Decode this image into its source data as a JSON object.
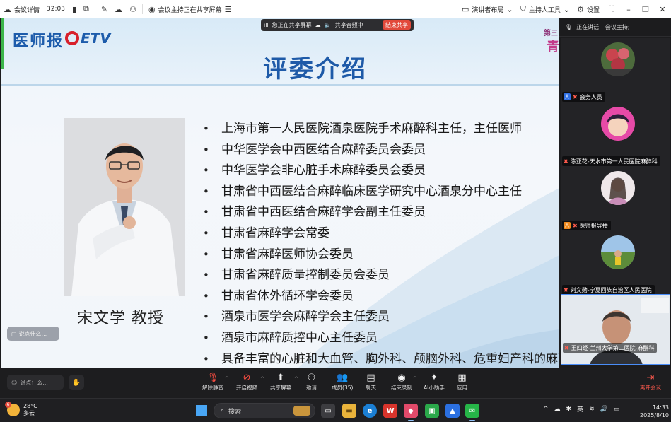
{
  "topbar": {
    "meeting_details": "会议详情",
    "duration": "32:03",
    "sharing_status": "会议主持正在共享屏幕",
    "presenter_layout": "演讲者布局",
    "host_tools": "主持人工具",
    "settings": "设置"
  },
  "share_bar": {
    "sharing_label": "您正在共享屏幕",
    "audio_label": "共享音频中",
    "end_share": "结束共享"
  },
  "slide": {
    "logo_text": "医师报",
    "logo_etv": "ETV",
    "title": "评委介绍",
    "corner_tag": "第三",
    "corner_tag2": "青",
    "person_name": "宋文学 教授",
    "bullets": [
      "上海市第一人民医院酒泉医院手术麻醉科主任，主任医师",
      "中华医学会中西医结合麻醉委员会委员",
      "中华医学会非心脏手术麻醉委员会委员",
      "甘肃省中西医结合麻醉临床医学研究中心酒泉分中心主任",
      "甘肃省中西医结合麻醉学会副主任委员",
      "甘肃省麻醉学会常委",
      "甘肃省麻醉医师协会委员",
      "甘肃省麻醉质量控制委员会委员",
      "甘肃省体外循环学会委员",
      "酒泉市医学会麻醉学会主任委员",
      "酒泉市麻醉质控中心主任委员",
      "具备丰富的心脏和大血管、胸外科、颅脑外科、危重妇产科的麻醉管"
    ],
    "chat_placeholder": "说点什么..."
  },
  "side": {
    "speaking_label": "正在讲话:",
    "speaking_name": "会议主持;",
    "participants": [
      {
        "name": "会务人员",
        "role_badge": "人"
      },
      {
        "name": "陈亚花-天水市第一人民医院麻醉科"
      },
      {
        "name": "医师报导播",
        "role_badge": "人"
      },
      {
        "name": "刘文勋-宁夏回族自治区人民医院"
      },
      {
        "name": "王四经-兰州大学第二医院-麻醉科"
      }
    ]
  },
  "toolbar": {
    "chat_placeholder": "说点什么...",
    "tools": [
      "解除静音",
      "开启视频",
      "共享屏幕",
      "邀请",
      "成员(35)",
      "聊天",
      "结束录制",
      "AI小助手",
      "应用"
    ],
    "leave": "离开会议"
  },
  "taskbar": {
    "temperature": "28°C",
    "weather": "多云",
    "weather_badge": "6",
    "search": "搜索",
    "input_method": "英",
    "time": "14:33",
    "date": "2025/8/10"
  },
  "colors": {
    "title_blue": "#1e5aa8",
    "end_red": "#e2493b",
    "leave_red": "#ff5a4e"
  }
}
